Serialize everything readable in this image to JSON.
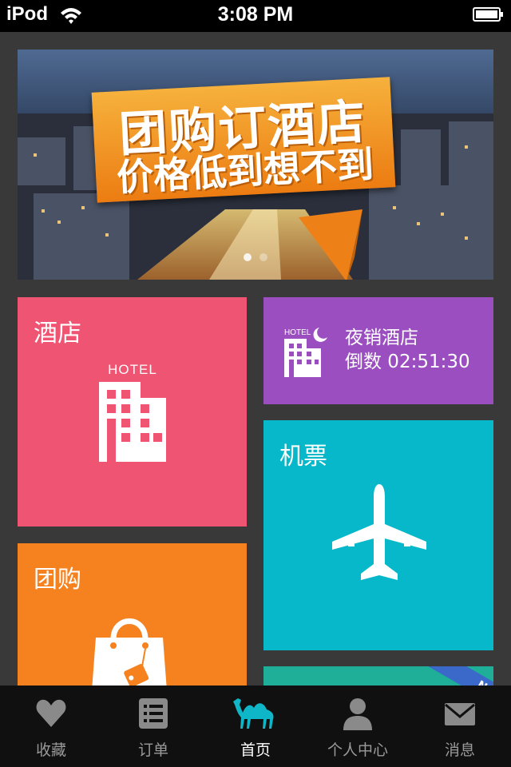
{
  "status_bar": {
    "carrier": "iPod",
    "time": "3:08 PM"
  },
  "banner": {
    "line1": "团购订酒店",
    "line2": "价格低到想不到",
    "page_count": 2,
    "active_page": 1
  },
  "tiles": {
    "hotel": {
      "label": "酒店",
      "icon_text": "HOTEL",
      "color": "#ef5472"
    },
    "night": {
      "line1": "夜销酒店",
      "line2": "倒数 02:51:30",
      "icon_text": "HOTEL",
      "color": "#9b4ec0"
    },
    "flight": {
      "label": "机票",
      "color": "#06b8c9"
    },
    "group": {
      "label": "团购",
      "color": "#f5811f"
    },
    "extra": {
      "ribbon": "N",
      "color": "#1fae97"
    }
  },
  "tab_bar": {
    "active": "首页",
    "items": [
      {
        "label": "收藏",
        "icon": "heart-icon"
      },
      {
        "label": "订单",
        "icon": "list-icon"
      },
      {
        "label": "首页",
        "icon": "camel-icon"
      },
      {
        "label": "个人中心",
        "icon": "person-icon"
      },
      {
        "label": "消息",
        "icon": "envelope-icon"
      }
    ]
  }
}
